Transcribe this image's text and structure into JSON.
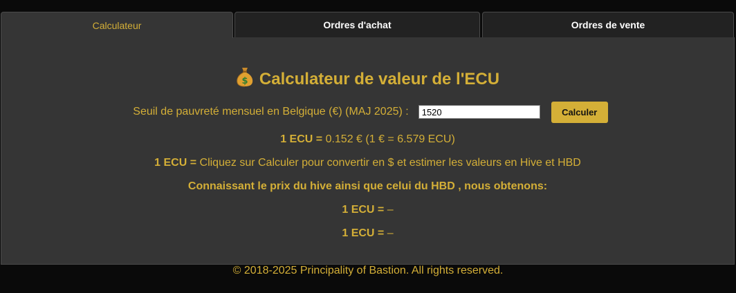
{
  "tabs": [
    {
      "label": "Calculateur",
      "active": true
    },
    {
      "label": "Ordres d'achat",
      "active": false
    },
    {
      "label": "Ordres de vente",
      "active": false
    }
  ],
  "calculator": {
    "title": "Calculateur de valeur de l'ECU",
    "title_icon": "money-bag-icon",
    "threshold_label": "Seuil de pauvreté mensuel en Belgique (€) (MAJ 2025) :",
    "threshold_value": "1520",
    "calculate_label": "Calculer",
    "ecu_prefix": "1 ECU =",
    "eur_rate": "0.152 € (1 € = 6.579 ECU)",
    "usd_text": "Cliquez sur Calculer pour convertir en $ et estimer les valeurs en Hive et HBD",
    "hive_hbd_heading": "Connaissant le prix du hive ainsi que celui du HBD , nous obtenons:",
    "hive_value": "–",
    "hbd_value": "–"
  },
  "footer": {
    "text": "© 2018-2025 Principality of Bastion. All rights reserved."
  },
  "colors": {
    "accent": "#d4af37",
    "background": "#0a0a0a",
    "panel": "#353535",
    "tab_inactive": "#222222"
  }
}
